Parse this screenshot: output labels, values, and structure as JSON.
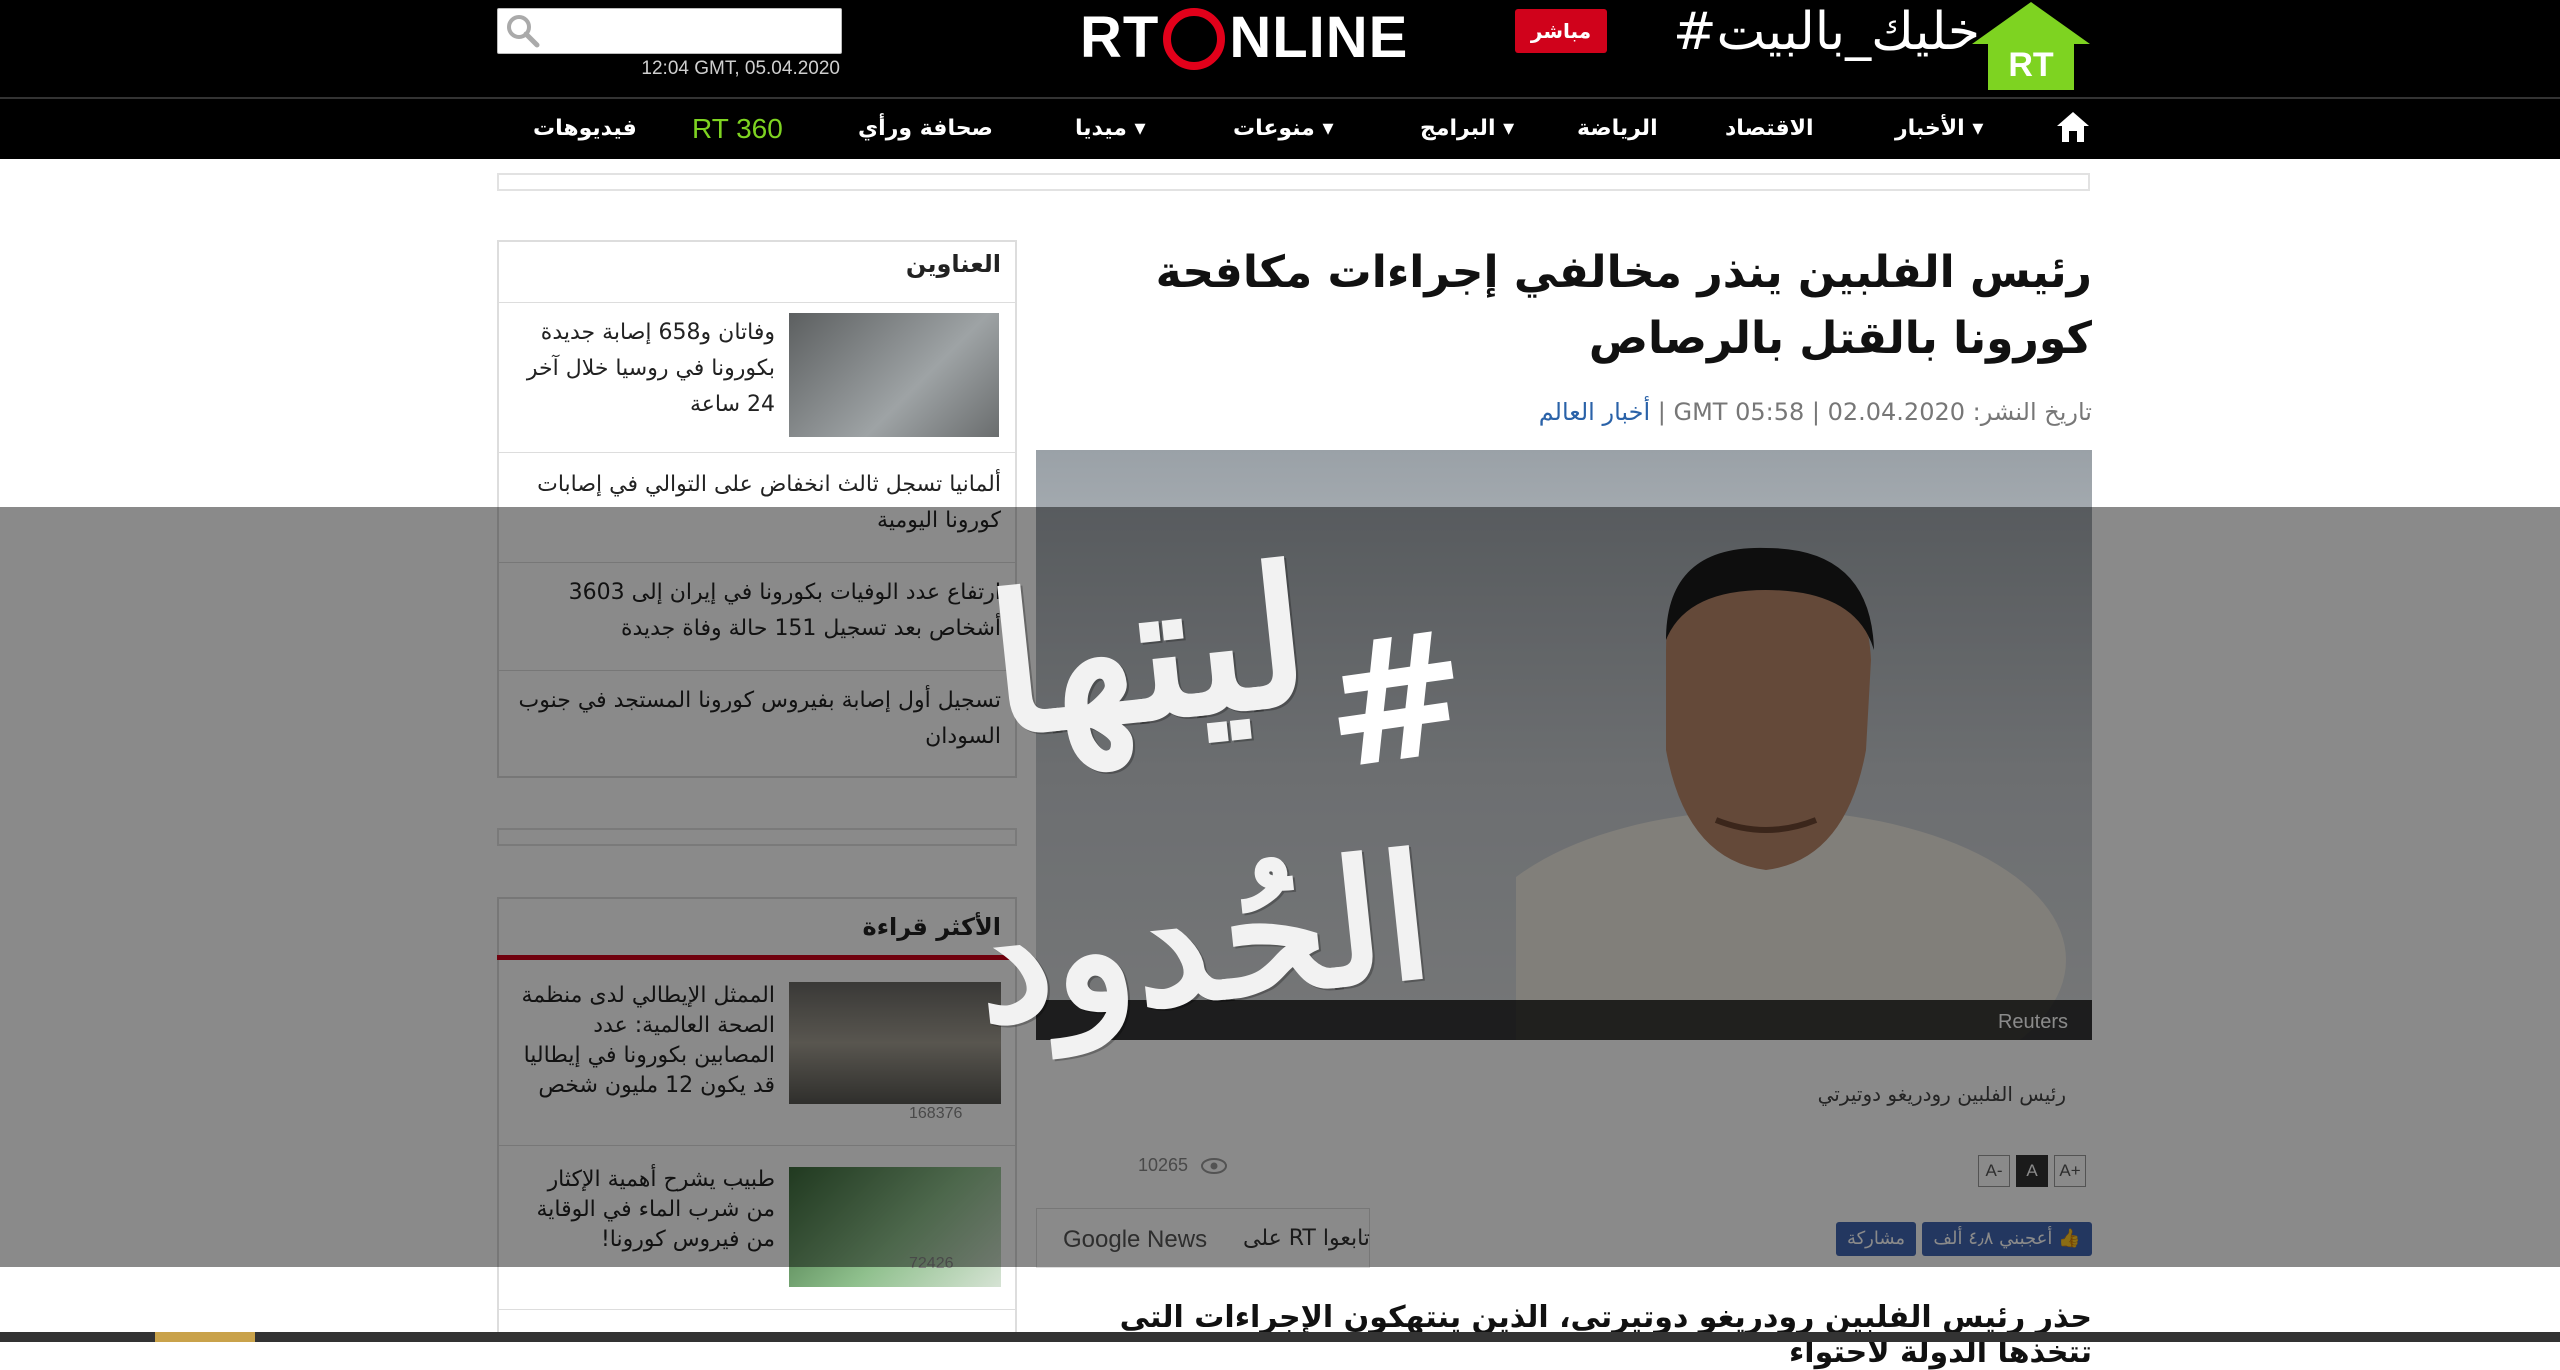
{
  "header": {
    "search_placeholder": "",
    "datetime": "12:04 GMT, 05.04.2020",
    "logo_left": "RT",
    "logo_right": "NLINE",
    "live_label": "مباشر",
    "hashtag": "#خليك_بالبيت"
  },
  "nav": {
    "items": [
      "الأخبار",
      "الاقتصاد",
      "الرياضة",
      "البرامج",
      "منوعات",
      "ميديا",
      "صحافة ورأي",
      "RT 360",
      "فيديوهات"
    ]
  },
  "article": {
    "headline": "رئيس الفلبين ينذر مخالفي إجراءات مكافحة كورونا بالقتل بالرصاص",
    "meta_prefix": "تاريخ النشر: 02.04.2020 | GMT 05:58 |",
    "meta_category": "أخبار العالم",
    "photo_credit": "Reuters",
    "photo_caption": "رئيس الفلبين رودريغو دوتيرتي",
    "font_buttons": [
      "A-",
      "A",
      "A+"
    ],
    "views": "10265",
    "follow_text": "تابعوا RT على",
    "google_news": "Google News",
    "like_label": "أعجبني ٤٫٨ ألف",
    "share_label": "مشاركة",
    "lead": "حذر رئيس الفلبين رودريغو دوتيرتي، الذين ينتهكون الإجراءات التي تتخذها الدولة لاحتواء"
  },
  "sidebar": {
    "headlines_title": "العناوين",
    "headlines": [
      "وفاتان و658 إصابة جديدة بكورونا في روسيا خلال آخر 24 ساعة",
      "ألمانيا تسجل ثالث انخفاض على التوالي في إصابات كورونا اليومية",
      "ارتفاع عدد الوفيات بكورونا في إيران إلى 3603 أشخاص بعد تسجيل 151 حالة وفاة جديدة",
      "تسجيل أول إصابة بفيروس كورونا المستجد في جنوب السودان"
    ],
    "most_read_title": "الأكثر قراءة",
    "most_read": [
      {
        "text": "الممثل الإيطالي لدى منظمة الصحة العالمية: عدد المصابين بكورونا في إيطاليا قد يكون 12 مليون شخص",
        "views": "168376"
      },
      {
        "text": "طبيب يشرح أهمية الإكثار من شرب الماء في الوقاية من فيروس كورونا!",
        "views": "72426"
      }
    ]
  },
  "overlay": {
    "hashtag": "#",
    "line1": "ليتها",
    "line2": "الحُدود"
  },
  "colors": {
    "brand_red": "#e2001a",
    "nav_green": "#7ed321",
    "link_blue": "#2a62a8",
    "fb_blue": "#4267b2"
  }
}
